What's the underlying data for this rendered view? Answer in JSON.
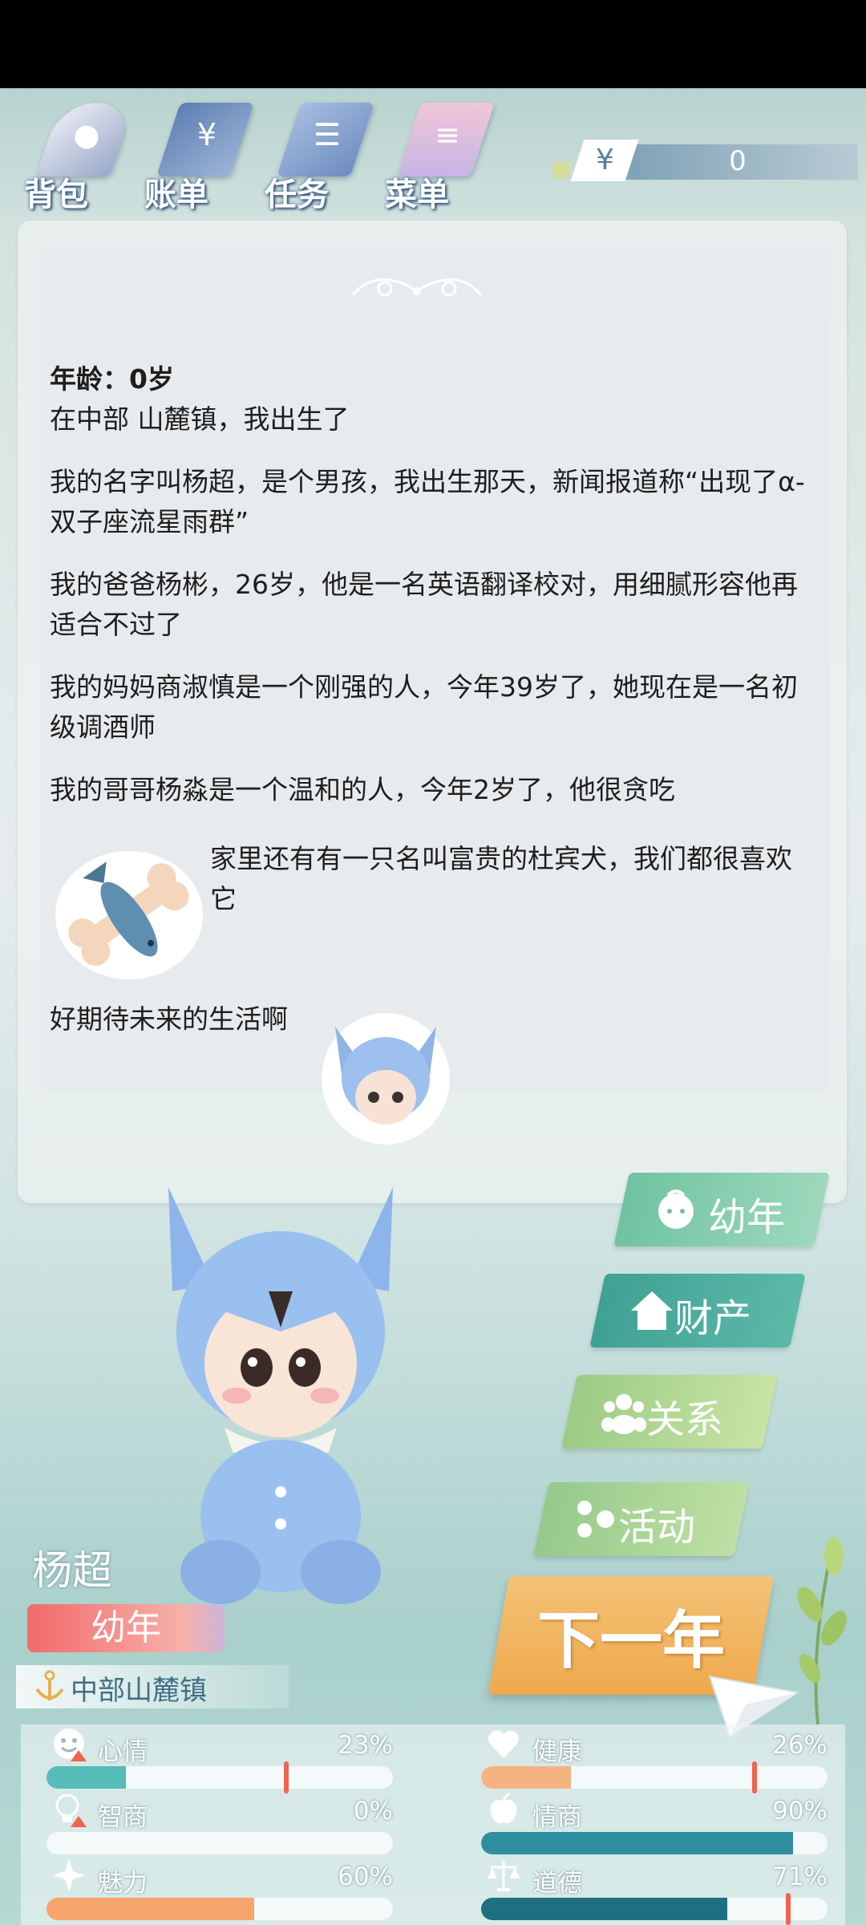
{
  "toolbar": {
    "items": [
      {
        "label": "背包",
        "icon": "bag-icon"
      },
      {
        "label": "账单",
        "icon": "bill-icon"
      },
      {
        "label": "任务",
        "icon": "task-icon"
      },
      {
        "label": "菜单",
        "icon": "menu-icon"
      }
    ],
    "money_symbol": "¥",
    "money_value": "0"
  },
  "story": {
    "age_line": "年龄：0岁",
    "lines": [
      "在中部 山麓镇，我出生了",
      "我的名字叫杨超，是个男孩，我出生那天，新闻报道称“出现了α-双子座流星雨群”",
      "我的爸爸杨彬，26岁，他是一名英语翻译校对，用细腻形容他再适合不过了",
      "我的妈妈商淑慎是一个刚强的人，今年39岁了，她现在是一名初级调酒师",
      "我的哥哥杨淼是一个温和的人，今年2岁了，他很贪吃"
    ],
    "pet_line": "家里还有有一只名叫富贵的杜宾犬，我们都很喜欢它",
    "closing_line": "好期待未来的生活啊"
  },
  "side_buttons": [
    {
      "label": "幼年",
      "icon": "baby-face-icon",
      "color": "#7cc7a4"
    },
    {
      "label": "财产",
      "icon": "house-icon",
      "color": "#4fa99b"
    },
    {
      "label": "关系",
      "icon": "people-icon",
      "color": "#a7cf8f"
    },
    {
      "label": "活动",
      "icon": "activity-icon",
      "color": "#9fcd8e"
    }
  ],
  "next_year_label": "下一年",
  "character": {
    "name": "杨超",
    "stage": "幼年",
    "location": "中部山麓镇"
  },
  "stats": [
    {
      "label": "心情",
      "value": "23%",
      "fraction": 0.23,
      "color": "#56bcb8",
      "warn": true
    },
    {
      "label": "健康",
      "value": "26%",
      "fraction": 0.26,
      "color": "#f6b382",
      "warn": false
    },
    {
      "label": "智商",
      "value": "0%",
      "fraction": 0.0,
      "color": "#56bcb8",
      "warn": true
    },
    {
      "label": "情商",
      "value": "90%",
      "fraction": 0.9,
      "color": "#2f8fa0",
      "warn": false
    },
    {
      "label": "魅力",
      "value": "60%",
      "fraction": 0.6,
      "color": "#f6a46c",
      "warn": false
    },
    {
      "label": "道德",
      "value": "71%",
      "fraction": 0.71,
      "color": "#1f6f83",
      "warn": false
    }
  ]
}
